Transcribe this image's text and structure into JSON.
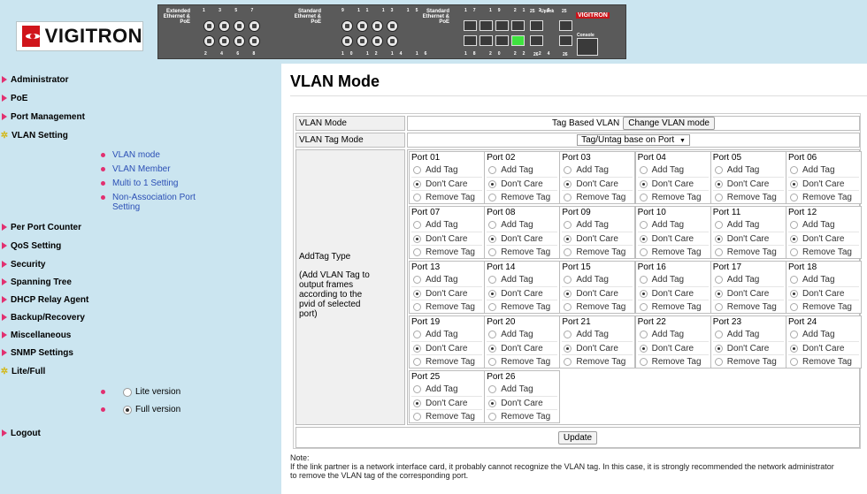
{
  "header": {
    "logo_text": "VIGITRON",
    "device": {
      "group1_label": "Extended Ethernet & PoE",
      "group1_top_ports": "1 3 5 7",
      "group1_bottom_ports": "2 4 6 8",
      "group2_label": "Standard Ethernet & PoE",
      "group2_top_ports": "9 11 13 15",
      "group2_bottom_ports": "10 12 14 16",
      "group3_label": "Standard Ethernet & PoE",
      "group3_top_ports": "17 19 21 23",
      "group3_bottom_ports": "18 20 22 24",
      "uplink_label": "Uplink",
      "uplink_top_ports": "25",
      "uplink_bottom_ports": "26",
      "extra_top": "25",
      "extra_bottom": "26",
      "console_label": "Console",
      "mini_logo": "VIGITRON",
      "active_sfp_color": "#3fe33f"
    }
  },
  "sidebar": {
    "items": [
      {
        "label": "Administrator",
        "icon": "arrow-icon"
      },
      {
        "label": "PoE",
        "icon": "arrow-icon"
      },
      {
        "label": "Port Management",
        "icon": "arrow-icon"
      },
      {
        "label": "VLAN Setting",
        "icon": "star-icon",
        "expanded": true
      },
      {
        "label": "Per Port Counter",
        "icon": "arrow-icon"
      },
      {
        "label": "QoS Setting",
        "icon": "arrow-icon"
      },
      {
        "label": "Security",
        "icon": "arrow-icon"
      },
      {
        "label": "Spanning Tree",
        "icon": "arrow-icon"
      },
      {
        "label": "DHCP Relay Agent",
        "icon": "arrow-icon"
      },
      {
        "label": "Backup/Recovery",
        "icon": "arrow-icon"
      },
      {
        "label": "Miscellaneous",
        "icon": "arrow-icon"
      },
      {
        "label": "SNMP Settings",
        "icon": "arrow-icon"
      },
      {
        "label": "Lite/Full",
        "icon": "star-icon"
      },
      {
        "label": "Logout",
        "icon": "arrow-icon"
      }
    ],
    "vlan_subitems": [
      "VLAN mode",
      "VLAN Member",
      "Multi to 1 Setting",
      "Non-Association Port Setting"
    ],
    "version_options": [
      {
        "label": "Lite version",
        "checked": false
      },
      {
        "label": "Full version",
        "checked": true
      }
    ]
  },
  "main": {
    "title": "VLAN Mode",
    "vlan_mode_label": "VLAN Mode",
    "vlan_mode_value": "Tag Based VLAN",
    "change_button": "Change VLAN mode",
    "tag_mode_label": "VLAN Tag Mode",
    "tag_mode_value": "Tag/Untag base on Port",
    "tag_mode_arrow": "▼",
    "addtag_label": "AddTag Type",
    "addtag_desc": "(Add VLAN Tag to output frames according to the pvid of selected port)",
    "options": [
      "Add Tag",
      "Don't Care",
      "Remove Tag"
    ],
    "ports": [
      {
        "name": "Port 01",
        "selected": "Don't Care"
      },
      {
        "name": "Port 02",
        "selected": "Don't Care"
      },
      {
        "name": "Port 03",
        "selected": "Don't Care"
      },
      {
        "name": "Port 04",
        "selected": "Don't Care"
      },
      {
        "name": "Port 05",
        "selected": "Don't Care"
      },
      {
        "name": "Port 06",
        "selected": "Don't Care"
      },
      {
        "name": "Port 07",
        "selected": "Don't Care"
      },
      {
        "name": "Port 08",
        "selected": "Don't Care"
      },
      {
        "name": "Port 09",
        "selected": "Don't Care"
      },
      {
        "name": "Port 10",
        "selected": "Don't Care"
      },
      {
        "name": "Port 11",
        "selected": "Don't Care"
      },
      {
        "name": "Port 12",
        "selected": "Don't Care"
      },
      {
        "name": "Port 13",
        "selected": "Don't Care"
      },
      {
        "name": "Port 14",
        "selected": "Don't Care"
      },
      {
        "name": "Port 15",
        "selected": "Don't Care"
      },
      {
        "name": "Port 16",
        "selected": "Don't Care"
      },
      {
        "name": "Port 17",
        "selected": "Don't Care"
      },
      {
        "name": "Port 18",
        "selected": "Don't Care"
      },
      {
        "name": "Port 19",
        "selected": "Don't Care"
      },
      {
        "name": "Port 20",
        "selected": "Don't Care"
      },
      {
        "name": "Port 21",
        "selected": "Don't Care"
      },
      {
        "name": "Port 22",
        "selected": "Don't Care"
      },
      {
        "name": "Port 23",
        "selected": "Don't Care"
      },
      {
        "name": "Port 24",
        "selected": "Don't Care"
      },
      {
        "name": "Port 25",
        "selected": "Don't Care"
      },
      {
        "name": "Port 26",
        "selected": "Don't Care"
      }
    ],
    "update_button": "Update",
    "note_title": "Note:",
    "note_text": "If the link partner is a network interface card, it probably cannot recognize the VLAN tag. In this case, it is strongly recommended the network administrator to remove the VLAN tag of the corresponding port."
  }
}
